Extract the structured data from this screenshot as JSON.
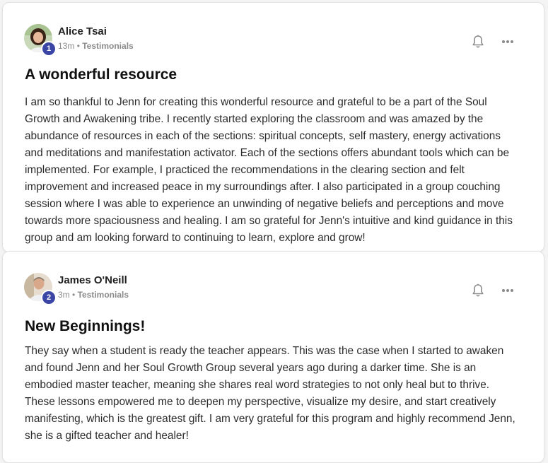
{
  "posts": [
    {
      "author": "Alice Tsai",
      "rank": "1",
      "time": "13m",
      "separator": "•",
      "category": "Testimonials",
      "title": "A wonderful resource",
      "body": "I am so thankful to Jenn for creating this wonderful resource and grateful to be a part of the Soul Growth and Awakening tribe. I recently started exploring the classroom and was amazed by the abundance of resources in each of the sections: spiritual concepts, self mastery, energy activations and meditations and manifestation activator. Each of the sections offers abundant tools which can be implemented. For example, I practiced the recommendations in the clearing section and felt improvement and increased peace in my surroundings after. I also participated in a group couching session where I was able to experience an unwinding of negative beliefs and perceptions and move towards more spaciousness and healing. I am so grateful for Jenn's intuitive and kind guidance in this group and am looking forward to continuing to learn, explore and grow!",
      "icons": {
        "follow": "bell-icon",
        "more": "more-horizontal-icon"
      }
    },
    {
      "author": "James O'Neill",
      "rank": "2",
      "time": "3m",
      "separator": "•",
      "category": "Testimonials",
      "title": "New Beginnings!",
      "body": "They say when a student is ready the teacher appears. This was the case when I started to awaken and found Jenn and her Soul Growth Group several years ago during a darker time. She is an embodied master teacher, meaning she shares real word strategies to not only heal but to thrive. These lessons empowered me to deepen my perspective, visualize my desire, and start creatively manifesting, which is the greatest gift. I am very grateful for this program and highly recommend Jenn, she is a gifted teacher and healer!",
      "icons": {
        "follow": "bell-icon",
        "more": "more-horizontal-icon"
      }
    }
  ],
  "colors": {
    "badge": "#3a45a6",
    "meta_text": "#8a8a8a",
    "icon": "#8a8a8a"
  }
}
